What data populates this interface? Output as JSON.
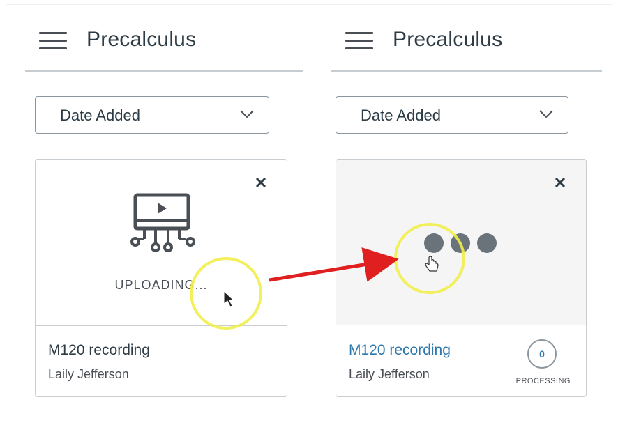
{
  "panels": [
    {
      "course_title": "Precalculus",
      "sort_label": "Date Added",
      "card": {
        "status_text": "UPLOADING...",
        "title": "M120 recording",
        "author": "Laily Jefferson"
      }
    },
    {
      "course_title": "Precalculus",
      "sort_label": "Date Added",
      "card": {
        "title": "M120 recording",
        "author": "Laily Jefferson",
        "processing_count": "0",
        "processing_label": "PROCESSING"
      }
    }
  ],
  "colors": {
    "link_blue": "#2e78ad",
    "highlight_circle": "#f1ee4a",
    "arrow": "#e02020"
  },
  "icons": [
    "hamburger-menu-icon",
    "chevron-down-icon",
    "close-icon",
    "video-upload-icon",
    "loading-dots-icon",
    "mouse-pointer-cursor",
    "hand-pointer-cursor"
  ]
}
